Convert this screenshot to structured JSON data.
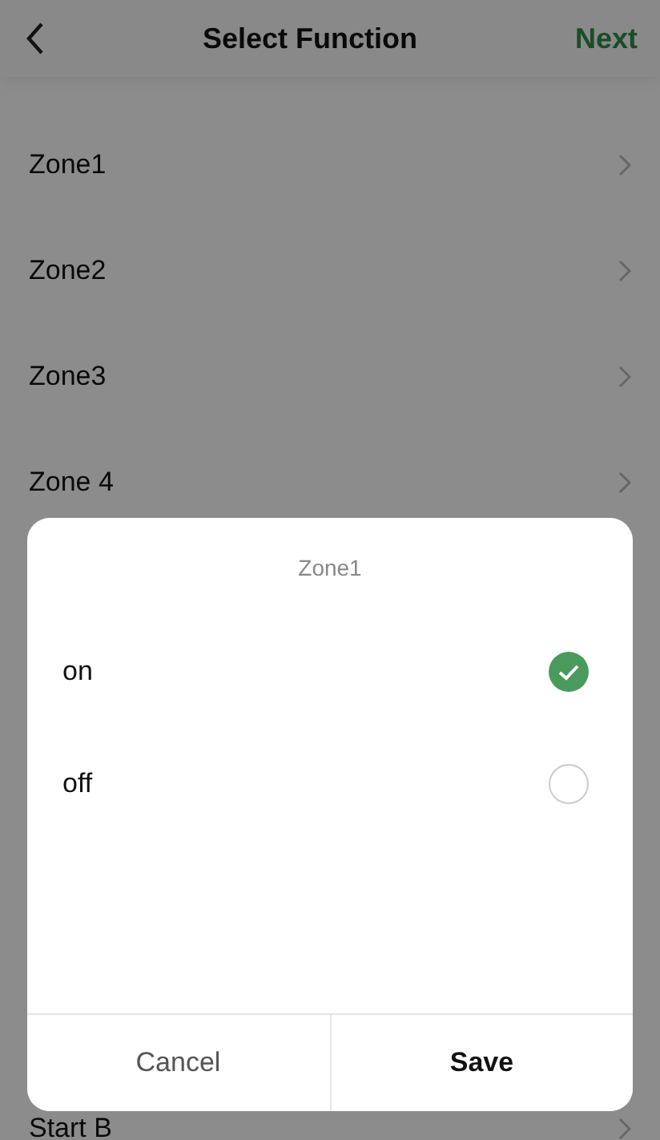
{
  "header": {
    "title": "Select Function",
    "action": "Next"
  },
  "rows": [
    {
      "label": "Zone1"
    },
    {
      "label": "Zone2"
    },
    {
      "label": "Zone3"
    },
    {
      "label": "Zone 4"
    }
  ],
  "bottom_rows": [
    {
      "label": "Start B"
    }
  ],
  "dialog": {
    "title": "Zone1",
    "options": [
      {
        "label": "on",
        "selected": true
      },
      {
        "label": "off",
        "selected": false
      }
    ],
    "buttons": [
      {
        "label": "Cancel",
        "kind": "secondary"
      },
      {
        "label": "Save",
        "kind": "primary"
      }
    ]
  }
}
